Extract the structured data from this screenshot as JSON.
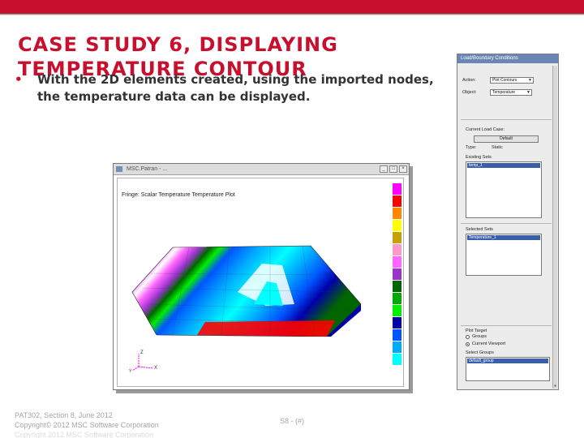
{
  "slide": {
    "title_line1": "CASE STUDY 6, DISPLAYING",
    "title_line2": "TEMPERATURE CONTOUR",
    "bullet_marker": "•",
    "bullet_text": "With the 2D elements created, using the imported nodes, the temperature data can be displayed.",
    "colors": {
      "accent_red": "#c8102e",
      "text_gray": "#333333",
      "footer_gray": "#a6a6a6"
    }
  },
  "plot_window": {
    "title": "MSC.Patran - ...",
    "plot_title": "Fringe: Scalar Temperature Temperature Plot",
    "legend": [
      {
        "label": "",
        "color": "#ff00ff"
      },
      {
        "label": "",
        "color": "#ff0000"
      },
      {
        "label": "",
        "color": "#ff8800"
      },
      {
        "label": "",
        "color": "#ffff00"
      },
      {
        "label": "",
        "color": "#c8a000"
      },
      {
        "label": "",
        "color": "#ff99cc"
      },
      {
        "label": "",
        "color": "#ff66ff"
      },
      {
        "label": "",
        "color": "#9933cc"
      },
      {
        "label": "",
        "color": "#006600"
      },
      {
        "label": "",
        "color": "#00aa00"
      },
      {
        "label": "",
        "color": "#00ee00"
      },
      {
        "label": "",
        "color": "#0000aa"
      },
      {
        "label": "",
        "color": "#0055ff"
      },
      {
        "label": "",
        "color": "#00aaff"
      },
      {
        "label": "",
        "color": "#00ffff"
      },
      {
        "label": "",
        "color": "#ffffff"
      }
    ],
    "axis_labels": {
      "z": "Z",
      "x": "X",
      "y": "Y"
    },
    "buttons": {
      "minimize": "_",
      "maximize": "□",
      "close": "×"
    }
  },
  "panel": {
    "title": "Load/Boundary Conditions",
    "fields": [
      {
        "label": "Action:",
        "value": "Plot Contours"
      },
      {
        "label": "Object:",
        "value": "Temperature"
      }
    ],
    "section_label": "Current Load Case:",
    "load_case_button": "Default",
    "type_label": "Type:",
    "type_value": "Static",
    "existing_sets_label": "Existing Sets",
    "existing_sets": [
      "temp_1"
    ],
    "selected_sets_label": "Selected Sets",
    "selected_sets": [
      "Temperature_1"
    ],
    "target_label": "Plot Target",
    "radio_options": [
      {
        "label": "Groups",
        "selected": false
      },
      {
        "label": "Current Viewport",
        "selected": true
      }
    ],
    "select_groups_label": "Select Groups",
    "select_groups": [
      "default_group"
    ]
  },
  "footer": {
    "line1": "PAT302, Section 8, June 2012",
    "line2": "Copyright© 2012 MSC Software Corporation",
    "ghost": "Copyright 2012 MSC Software Corporation",
    "slide_number": "S8 - (#)"
  }
}
